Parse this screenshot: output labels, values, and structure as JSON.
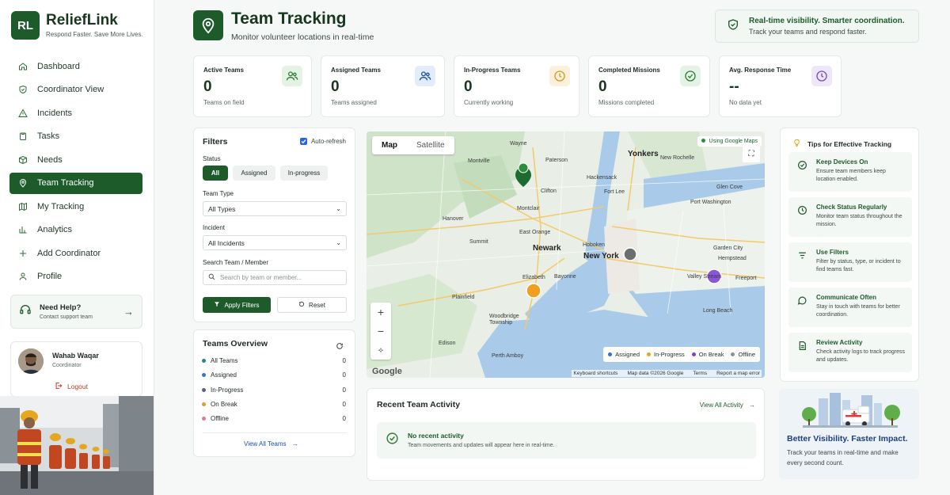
{
  "brand": {
    "logo": "RL",
    "name": "ReliefLink",
    "tagline": "Respond Faster. Save More Lives."
  },
  "nav": [
    {
      "label": "Dashboard",
      "icon": "home-icon"
    },
    {
      "label": "Coordinator View",
      "icon": "shield-icon"
    },
    {
      "label": "Incidents",
      "icon": "warning-icon"
    },
    {
      "label": "Tasks",
      "icon": "clipboard-icon"
    },
    {
      "label": "Needs",
      "icon": "box-icon"
    },
    {
      "label": "Team Tracking",
      "icon": "location-pin-icon",
      "active": true
    },
    {
      "label": "My Tracking",
      "icon": "map-icon"
    },
    {
      "label": "Analytics",
      "icon": "bar-chart-icon"
    },
    {
      "label": "Add Coordinator",
      "icon": "plus-icon"
    },
    {
      "label": "Profile",
      "icon": "user-icon"
    }
  ],
  "help": {
    "title": "Need Help?",
    "subtitle": "Contact support team"
  },
  "profile": {
    "name": "Wahab Waqar",
    "role": "Coordinator",
    "logout": "Logout"
  },
  "header": {
    "title": "Team Tracking",
    "subtitle": "Monitor volunteer locations in real-time"
  },
  "banner": {
    "title": "Real-time visibility. Smarter coordination.",
    "subtitle": "Track your teams and respond faster."
  },
  "stats": [
    {
      "label": "Active Teams",
      "value": "0",
      "sub": "Teams on field",
      "icon": "users-icon",
      "color": "#2e7d32",
      "bg": "#e4f3e6"
    },
    {
      "label": "Assigned Teams",
      "value": "0",
      "sub": "Teams assigned",
      "icon": "users-icon",
      "color": "#1e4fa8",
      "bg": "#e3ecfa"
    },
    {
      "label": "In-Progress Teams",
      "value": "0",
      "sub": "Currently working",
      "icon": "clock-icon",
      "color": "#d99a1c",
      "bg": "#fbf1dc"
    },
    {
      "label": "Completed Missions",
      "value": "0",
      "sub": "Missions completed",
      "icon": "check-circle-icon",
      "color": "#2e7d32",
      "bg": "#e4f3e6"
    },
    {
      "label": "Avg. Response Time",
      "value": "--",
      "sub": "No data yet",
      "icon": "clock-icon",
      "color": "#7b4bc4",
      "bg": "#efe6fa"
    }
  ],
  "filters": {
    "title": "Filters",
    "auto_refresh": "Auto-refresh",
    "status_label": "Status",
    "status_options": [
      "All",
      "Assigned",
      "In-progress"
    ],
    "team_type_label": "Team Type",
    "team_type_value": "All Types",
    "incident_label": "Incident",
    "incident_value": "All Incidents",
    "search_label": "Search Team / Member",
    "search_placeholder": "Search by team or member...",
    "apply": "Apply Filters",
    "reset": "Reset"
  },
  "overview": {
    "title": "Teams Overview",
    "rows": [
      {
        "label": "All Teams",
        "count": "0",
        "color": "#1f8a8a"
      },
      {
        "label": "Assigned",
        "count": "0",
        "color": "#3b6fd1"
      },
      {
        "label": "In-Progress",
        "count": "0",
        "color": "#5d5d8a"
      },
      {
        "label": "On Break",
        "count": "0",
        "color": "#e0a019"
      },
      {
        "label": "Offline",
        "count": "0",
        "color": "#e5798a"
      }
    ],
    "view_all": "View All Teams"
  },
  "map": {
    "tabs": [
      "Map",
      "Satellite"
    ],
    "badge": "Using Google Maps",
    "legend": [
      {
        "label": "Assigned",
        "color": "#2f6fd6"
      },
      {
        "label": "In-Progress",
        "color": "#f0a020"
      },
      {
        "label": "On Break",
        "color": "#7e3fcf"
      },
      {
        "label": "Offline",
        "color": "#8a8f92"
      }
    ],
    "google": "Google",
    "attribution": [
      "Keyboard shortcuts",
      "Map data ©2026 Google",
      "Terms",
      "Report a map error"
    ],
    "places": [
      "Wayne",
      "Paterson",
      "Yonkers",
      "New Rochelle",
      "Montville",
      "Hackensack",
      "Fort Lee",
      "Glen Cove",
      "Clifton",
      "Port Washington",
      "Montclair",
      "Hanover",
      "East Orange",
      "Summit",
      "Hoboken",
      "Garden City",
      "Hempstead",
      "Newark",
      "New York",
      "Elizabeth",
      "Bayonne",
      "Valley Stream",
      "Freeport",
      "Plainfield",
      "Long Beach",
      "Woodbridge Township",
      "Edison",
      "Perth Amboy"
    ]
  },
  "activity": {
    "title": "Recent Team Activity",
    "view_all": "View All Activity",
    "empty_title": "No recent activity",
    "empty_sub": "Team movements and updates will appear here in real-time."
  },
  "tips": {
    "title": "Tips for Effective Tracking",
    "items": [
      {
        "title": "Keep Devices On",
        "body": "Ensure team members keep location enabled.",
        "icon": "check-circle-icon"
      },
      {
        "title": "Check Status Regularly",
        "body": "Monitor team status throughout the mission.",
        "icon": "clock-icon"
      },
      {
        "title": "Use Filters",
        "body": "Filter by status, type, or incident to find teams fast.",
        "icon": "filter-icon"
      },
      {
        "title": "Communicate Often",
        "body": "Stay in touch with teams for better coordination.",
        "icon": "chat-icon"
      },
      {
        "title": "Review Activity",
        "body": "Check activity logs to track progress and updates.",
        "icon": "document-icon"
      }
    ]
  },
  "promo": {
    "title": "Better Visibility. Faster Impact.",
    "subtitle": "Track your teams in real-time and make every second count."
  }
}
